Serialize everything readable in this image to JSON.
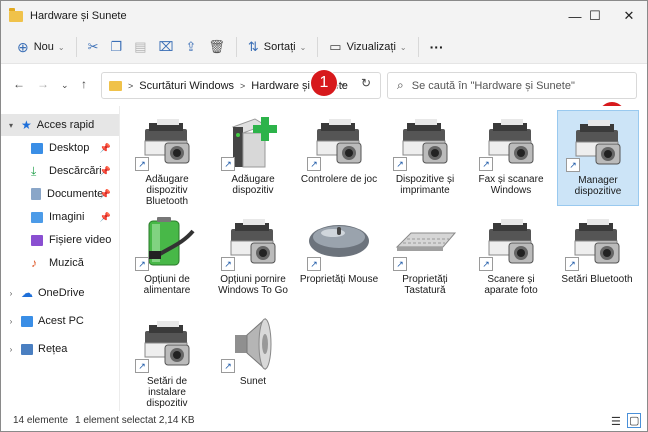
{
  "window": {
    "title": "Hardware și Sunete",
    "controls": [
      "—",
      "☐",
      "✕"
    ]
  },
  "toolbar": {
    "new_label": "Nou",
    "sort_label": "Sortați",
    "view_label": "Vizualizați",
    "more": "···"
  },
  "address": {
    "crumbs": [
      "Scurtături Windows",
      "Hardware și Sunete"
    ],
    "separator": ">",
    "search_placeholder": "Se caută în \"Hardware și Sunete\""
  },
  "badges": [
    "1",
    "2"
  ],
  "sidebar": {
    "items": [
      {
        "label": "Acces rapid",
        "pinned": false
      },
      {
        "label": "Desktop",
        "pinned": true
      },
      {
        "label": "Descărcări",
        "pinned": true
      },
      {
        "label": "Documente",
        "pinned": true
      },
      {
        "label": "Imagini",
        "pinned": true
      },
      {
        "label": "Fișiere video",
        "pinned": false
      },
      {
        "label": "Muzică",
        "pinned": false
      },
      {
        "label": "OneDrive",
        "pinned": false
      },
      {
        "label": "Acest PC",
        "pinned": false
      },
      {
        "label": "Rețea",
        "pinned": false
      }
    ],
    "pin_glyph": "📌"
  },
  "items": [
    {
      "label": "Adăugare dispozitiv Bluetooth",
      "icon": "printer-camera-icon"
    },
    {
      "label": "Adăugare dispozitiv",
      "icon": "add-device-icon"
    },
    {
      "label": "Controlere de joc",
      "icon": "printer-camera-icon"
    },
    {
      "label": "Dispozitive și imprimante",
      "icon": "printer-camera-icon"
    },
    {
      "label": "Fax și scanare Windows",
      "icon": "printer-camera-icon"
    },
    {
      "label": "Manager dispozitive",
      "icon": "printer-camera-icon"
    },
    {
      "label": "Opțiuni de alimentare",
      "icon": "battery-icon"
    },
    {
      "label": "Opțiuni pornire Windows To Go",
      "icon": "printer-camera-icon"
    },
    {
      "label": "Proprietăți Mouse",
      "icon": "mouse-icon"
    },
    {
      "label": "Proprietăți Tastatură",
      "icon": "keyboard-icon"
    },
    {
      "label": "Scanere și aparate foto",
      "icon": "printer-camera-icon"
    },
    {
      "label": "Setări Bluetooth",
      "icon": "printer-camera-icon"
    },
    {
      "label": "Setări de instalare dispozitiv",
      "icon": "printer-camera-icon"
    },
    {
      "label": "Sunet",
      "icon": "speaker-icon"
    }
  ],
  "status": {
    "count": "14 elemente",
    "selection": "1 element selectat  2,14 KB"
  },
  "colors": {
    "accent": "#0078d4",
    "badge": "#d7191c",
    "selection": "#cce4f7"
  }
}
